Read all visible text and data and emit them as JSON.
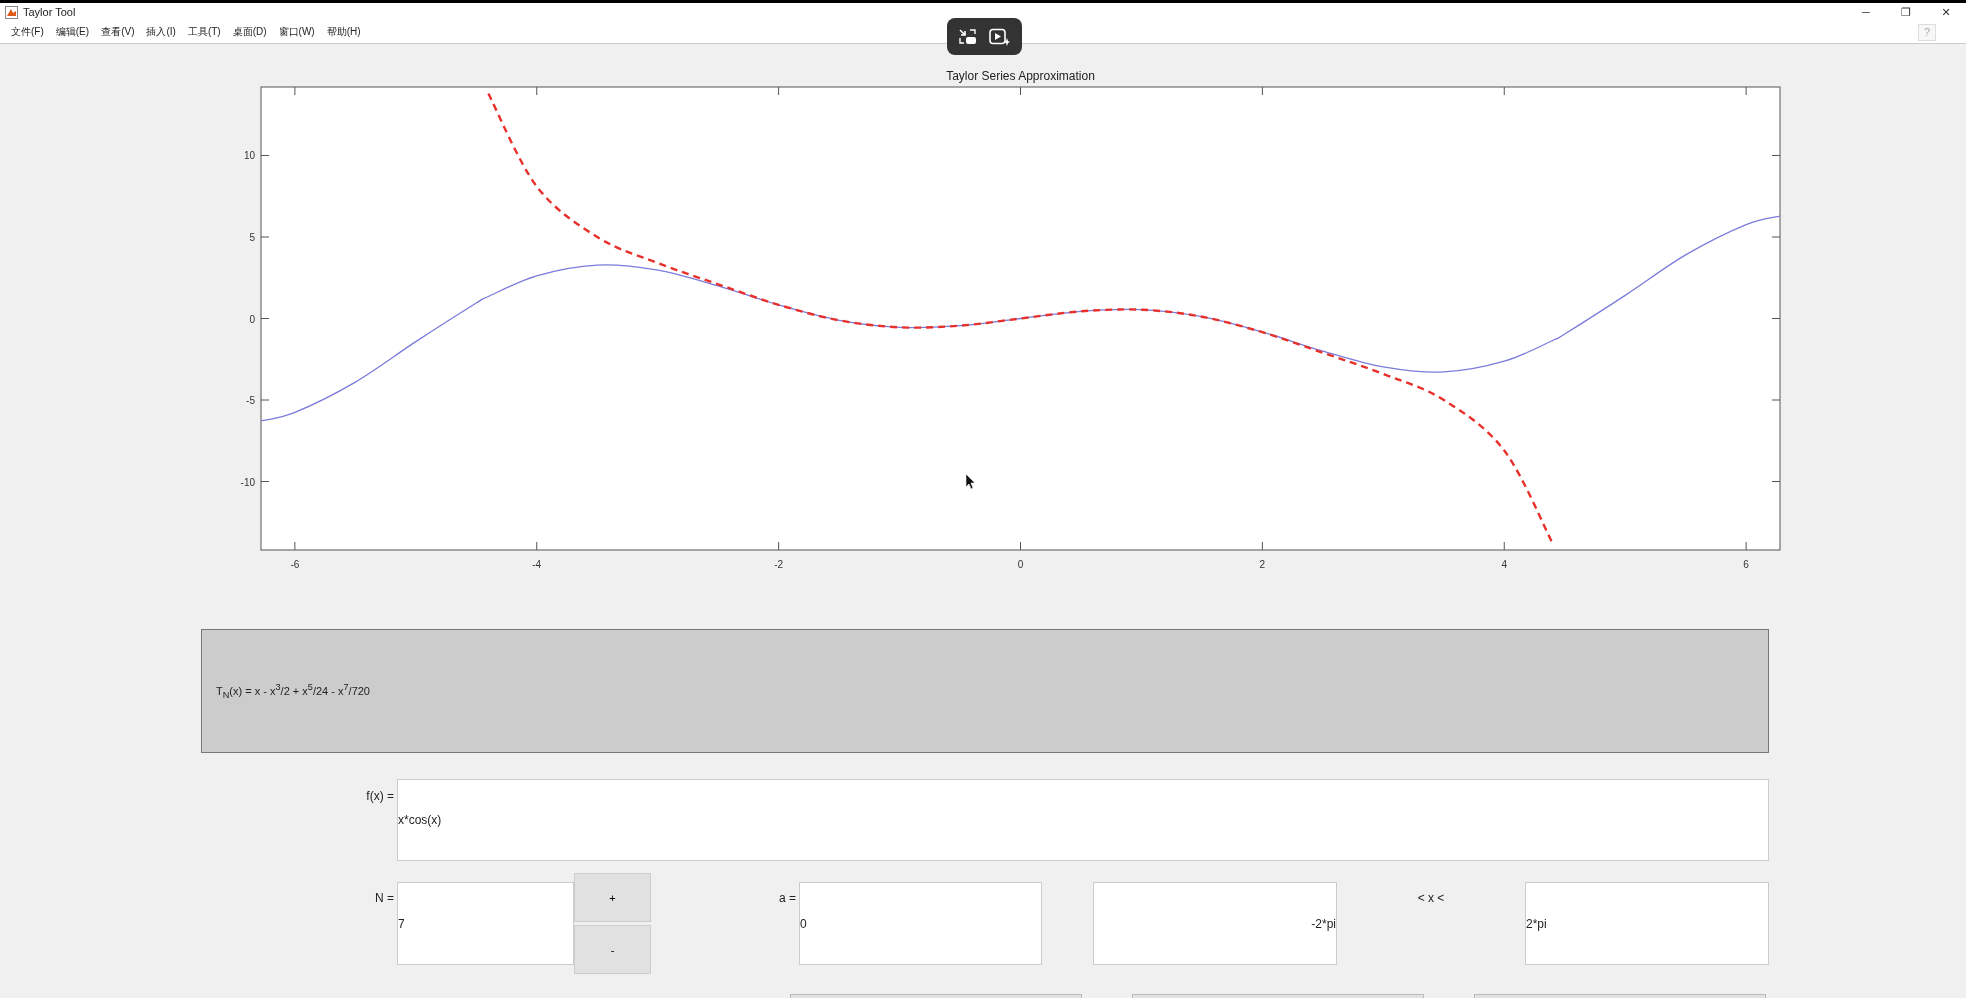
{
  "window": {
    "title": "Taylor Tool",
    "controls": [
      "─",
      "❐",
      "✕"
    ]
  },
  "menu": [
    "文件(F)",
    "编辑(E)",
    "查看(V)",
    "插入(I)",
    "工具(T)",
    "桌面(D)",
    "窗口(W)",
    "帮助(H)"
  ],
  "help_button": "?",
  "plot": {
    "chart_data": {
      "type": "line",
      "title": "Taylor Series Approximation",
      "x": [
        -6.28,
        -6,
        -5.5,
        -5,
        -4.5,
        -4.4,
        -4,
        -3.5,
        -3,
        -2.5,
        -2,
        -1.5,
        -1,
        -0.5,
        0,
        0.5,
        1,
        1.5,
        2,
        2.5,
        3,
        3.5,
        4,
        4.4,
        4.5,
        5,
        5.5,
        6,
        6.28
      ],
      "xlim": [
        -6.28,
        6.28
      ],
      "ylim": [
        -14.2,
        14.2
      ],
      "xticks": [
        -6,
        -4,
        -2,
        0,
        2,
        4,
        6
      ],
      "yticks": [
        -10,
        -5,
        0,
        5,
        10
      ],
      "series": [
        {
          "color": "#7b7bdc",
          "line_style": "solid",
          "values": [
            -6.28,
            -5.76,
            -3.9,
            -1.42,
            0.95,
            1.35,
            2.62,
            3.28,
            2.97,
            2.0,
            0.83,
            -0.11,
            -0.54,
            -0.44,
            0,
            0.44,
            0.54,
            0.11,
            -0.83,
            -2.0,
            -2.97,
            -3.28,
            -2.62,
            -1.35,
            -0.95,
            1.42,
            3.9,
            5.76,
            6.28
          ]
        },
        {
          "color": "#e8302a",
          "line_style": "dashed",
          "values": [
            null,
            null,
            null,
            null,
            null,
            13.8,
            8.1,
            5.0,
            3.4,
            2.1,
            0.84,
            -0.11,
            -0.54,
            -0.44,
            0,
            0.44,
            0.54,
            0.11,
            -0.84,
            -2.1,
            -3.4,
            -5.0,
            -8.1,
            -13.8,
            null,
            null,
            null,
            null,
            null
          ]
        }
      ]
    }
  },
  "formula": "T$_{N}$(x) = x - x$^{3}$/2 + x$^{5}$/24 - x$^{7}$/720",
  "function_field": {
    "label": "f(x) =",
    "value": "x*cos(x)"
  },
  "order": {
    "label": "N =",
    "value": "7",
    "increment": "+",
    "decrement": "-"
  },
  "center": {
    "label": "a =",
    "value": "0"
  },
  "range": {
    "min": "-2*pi",
    "separator": "< x <",
    "max": "2*pi"
  },
  "bottom_buttons": [
    {
      "kind": "button"
    },
    {
      "kind": "button"
    },
    {
      "kind": "button"
    }
  ]
}
